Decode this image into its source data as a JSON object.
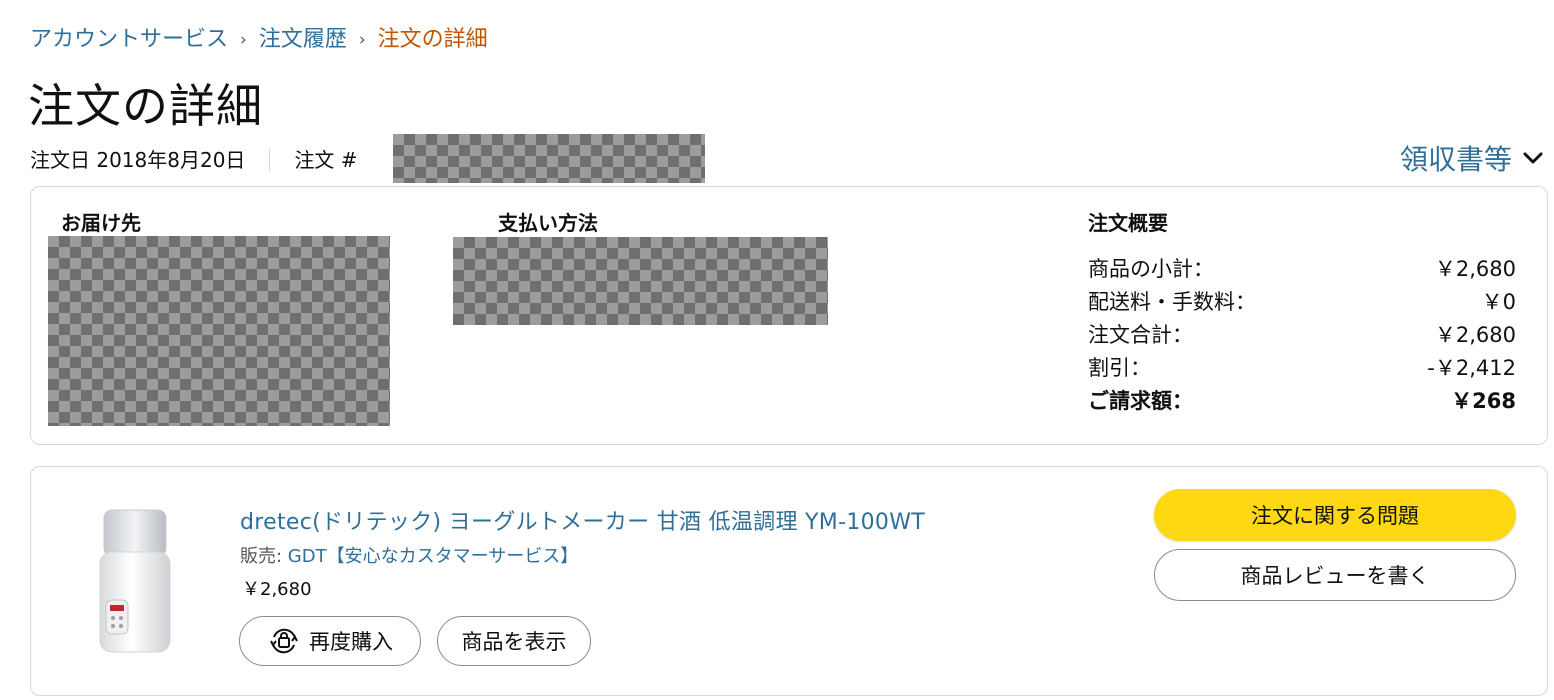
{
  "breadcrumb": {
    "items": [
      "アカウントサービス",
      "注文履歴",
      "注文の詳細"
    ],
    "separator": "›"
  },
  "page": {
    "title": "注文の詳細",
    "order_date": "注文日 2018年8月20日",
    "order_label": "注文 #",
    "receipt_link": "領収書等"
  },
  "shipping": {
    "heading": "お届け先"
  },
  "payment": {
    "heading": "支払い方法"
  },
  "summary": {
    "heading": "注文概要",
    "rows": [
      {
        "label": "商品の小計：",
        "value": "￥2,680"
      },
      {
        "label": "配送料・手数料：",
        "value": "￥0"
      },
      {
        "label": "注文合計：",
        "value": "￥2,680"
      },
      {
        "label": "割引：",
        "value": "-￥2,412"
      },
      {
        "label": "ご請求額：",
        "value": "￥268"
      }
    ]
  },
  "item": {
    "title": "dretec(ドリテック) ヨーグルトメーカー 甘酒 低温調理 YM-100WT",
    "seller_label": "販売: ",
    "seller": "GDT【安心なカスタマーサービス】",
    "price": "￥2,680",
    "rebuy_label": "再度購入",
    "view_label": "商品を表示"
  },
  "actions": {
    "problem_label": "注文に関する問題",
    "review_label": "商品レビューを書く"
  },
  "colors": {
    "link": "#2f6f99",
    "current_crumb": "#c45500",
    "primary_button": "#ffd814",
    "border": "#d5d9d9"
  },
  "icons": {
    "rebuy": "reorder-cart-icon",
    "dropdown": "chevron-down-icon"
  }
}
